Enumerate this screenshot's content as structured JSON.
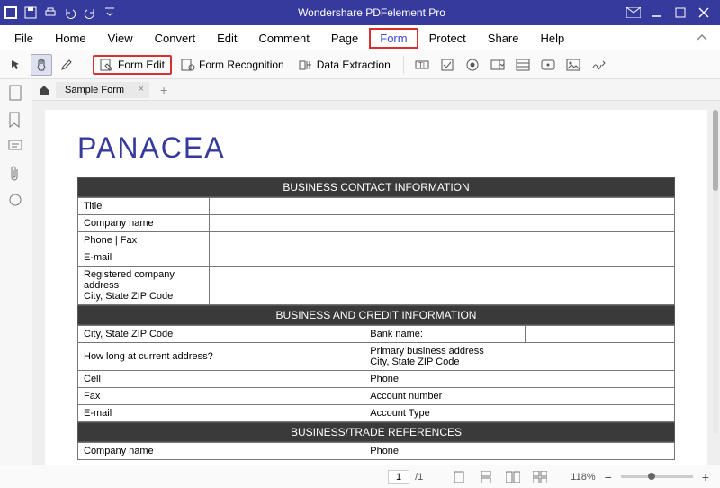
{
  "titlebar": {
    "title": "Wondershare PDFelement Pro"
  },
  "menubar": {
    "items": [
      "File",
      "Home",
      "View",
      "Convert",
      "Edit",
      "Comment",
      "Page",
      "Form",
      "Protect",
      "Share",
      "Help"
    ],
    "activeIndex": 7
  },
  "toolbar": {
    "formEdit": "Form Edit",
    "formRecognition": "Form Recognition",
    "dataExtraction": "Data Extraction"
  },
  "tab": {
    "name": "Sample Form"
  },
  "doc": {
    "title": "PANACEA",
    "sec1": {
      "head": "BUSINESS CONTACT INFORMATION",
      "r1": "Title",
      "r2": "Company name",
      "r3": "Phone | Fax",
      "r4": "E-mail",
      "r5a": "Registered company address",
      "r5b": "City, State ZIP Code"
    },
    "sec2": {
      "head": "BUSINESS AND CREDIT INFORMATION",
      "r1a": "City, State ZIP Code",
      "r1b": "Bank name:",
      "r2a": "How long at current address?",
      "r2b1": "Primary business address",
      "r2b2": "City, State ZIP Code",
      "r3a": "Cell",
      "r3b": "Phone",
      "r4a": "Fax",
      "r4b": "Account number",
      "r5a": "E-mail",
      "r5b": "Account Type"
    },
    "sec3": {
      "head": "BUSINESS/TRADE REFERENCES",
      "r1a": "Company name",
      "r1b": "Phone"
    }
  },
  "status": {
    "page": "1",
    "pages": "/1",
    "zoom": "118%",
    "minus": "−",
    "plus": "+"
  }
}
